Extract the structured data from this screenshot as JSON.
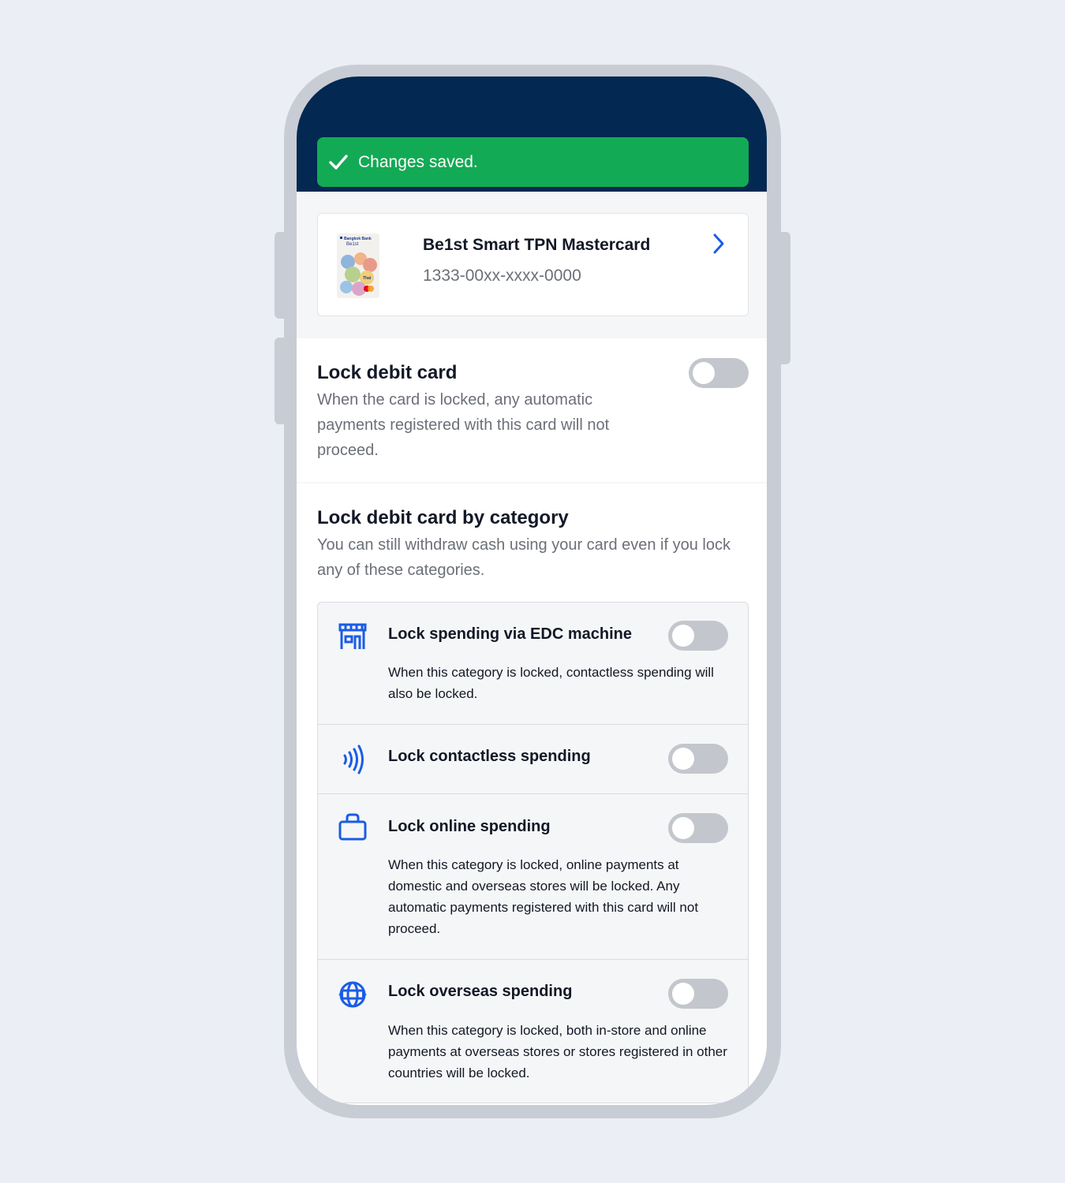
{
  "toast": {
    "message": "Changes saved.",
    "icon": "check-icon",
    "color": "#13aa55"
  },
  "header": {
    "color": "#032851"
  },
  "card": {
    "name": "Be1st Smart TPN Mastercard",
    "number": "1333-00xx-xxxx-0000",
    "image_text": {
      "bank": "Bangkok Bank",
      "brand": "Be1st",
      "network": "Thai"
    }
  },
  "lock_card": {
    "title": "Lock debit card",
    "description": "When the card is locked, any automatic payments registered with this card will not proceed.",
    "enabled": false
  },
  "categories_section": {
    "title": "Lock debit card by category",
    "description": "You can still withdraw cash using your card even if you lock any of these categories.",
    "items": [
      {
        "title": "Lock spending via EDC machine",
        "description": "When this category is locked, contactless spending will also be locked.",
        "icon": "store-icon",
        "enabled": false
      },
      {
        "title": "Lock contactless spending",
        "description": "",
        "icon": "contactless-icon",
        "enabled": false
      },
      {
        "title": "Lock online spending",
        "description": "When this category is locked, online payments at domestic and overseas stores will be locked. Any automatic payments registered with this card will not proceed.",
        "icon": "shopping-bag-icon",
        "enabled": false
      },
      {
        "title": "Lock overseas spending",
        "description": "When this category is locked, both in-store and online payments at overseas stores or stores registered in other countries will be locked.",
        "icon": "globe-icon",
        "enabled": false
      }
    ]
  },
  "colors": {
    "accent": "#1a5ce6",
    "toggle_off": "#c3c7cd"
  }
}
